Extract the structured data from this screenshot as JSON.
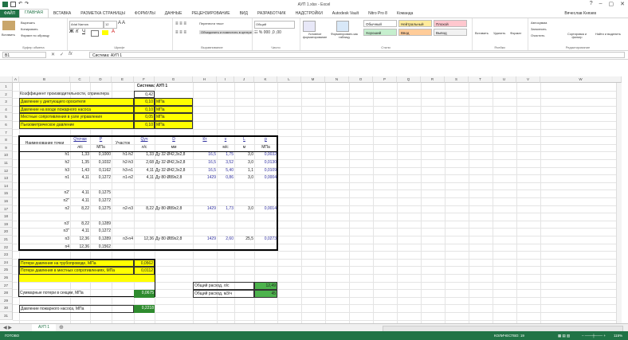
{
  "app": {
    "title": "АУП 1.xlsx - Excel",
    "user": "Вячеслав Князев"
  },
  "tabs": [
    "ФАЙЛ",
    "ГЛАВНАЯ",
    "ВСТАВКА",
    "РАЗМЕТКА СТРАНИЦЫ",
    "ФОРМУЛЫ",
    "ДАННЫЕ",
    "РЕЦЕНЗИРОВАНИЕ",
    "ВИД",
    "РАЗРАБОТЧИК",
    "НАДСТРОЙКИ",
    "Autodesk Vault",
    "Nitro Pro 8",
    "Команда"
  ],
  "ribbon": {
    "paste": "Вставить",
    "cut": "Вырезать",
    "copy": "Копировать",
    "format_painter": "Формат по образцу",
    "clipboard": "Буфер обмена",
    "font_name": "Arial Narrow",
    "font_size": "12",
    "font": "Шрифт",
    "wrap": "Перенести текст",
    "merge": "Объединить и поместить в центре",
    "alignment": "Выравнивание",
    "number_format": "Общий",
    "number": "Число",
    "conditional": "Условное форматирование",
    "format_table": "Форматировать как таблицу",
    "styles_label": "Стили",
    "style_normal": "Обычный",
    "style_neutral": "Нейтральный",
    "style_bad": "Плохой",
    "style_good": "Хороший",
    "style_input": "Ввод",
    "style_calc": "Вывод",
    "insert": "Вставить",
    "delete": "Удалить",
    "format": "Формат",
    "cells": "Ячейки",
    "autosum": "Автосумма",
    "fill": "Заполнить",
    "clear": "Очистить",
    "sort": "Сортировка и фильтр",
    "find": "Найти и выделить",
    "editing": "Редактирование"
  },
  "formula_bar": {
    "name_box": "B1",
    "formula": "Система: АУП 1"
  },
  "columns": [
    "A",
    "B",
    "C",
    "D",
    "E",
    "F",
    "G",
    "H",
    "I",
    "J",
    "K",
    "L",
    "M",
    "N",
    "O",
    "P",
    "Q",
    "R",
    "S",
    "T",
    "U",
    "V",
    "W"
  ],
  "rows": [
    "1",
    "2",
    "3",
    "4",
    "5",
    "6",
    "7",
    "8",
    "9",
    "10",
    "11",
    "12",
    "13",
    "14",
    "15",
    "16",
    "17",
    "18",
    "19",
    "20",
    "21",
    "22",
    "23",
    "24",
    "25",
    "26",
    "27",
    "28",
    "29",
    "30",
    "31"
  ],
  "cells": {
    "title": "Система: АУП 1",
    "r2_label": "Коэффициент производительности, спринклера",
    "r2_val": "0,42",
    "r3_label": "Давление у диктующего оросителя",
    "r3_val": "0,10",
    "r3_unit": "МПа",
    "r4_label": "Давление на входе пожарного насоса",
    "r4_val": "0,10",
    "r4_unit": "МПа",
    "r5_label": "Местные сопротивления в узле управления",
    "r5_val": "0,05",
    "r5_unit": "МПа",
    "r6_label": "Пьезометрическое давление",
    "r6_val": "0,10",
    "r6_unit": "МПа",
    "h_name": "Наименование точки",
    "h_q": "Qточки",
    "h_q_u": "л/с",
    "h_p": "P",
    "h_p_u": "МПа",
    "h_sec": "Участок",
    "h_qu": "Qуч",
    "h_qu_u": "л/с",
    "h_d": "D",
    "h_d_u": "мм",
    "h_kt": "Кт",
    "h_v": "v",
    "h_v_u": "м/с",
    "h_l": "L",
    "h_l_u": "м",
    "h_pp": "p",
    "h_pp_u": "МПа",
    "rows": [
      {
        "b": "h1",
        "c": "1,33",
        "d": "0,1000",
        "e": "h1-h2",
        "f": "1,33",
        "g": "Ду 32 Ø42,3х2,8",
        "h": "16,5",
        "i": "1,75",
        "j": "3,0",
        "k": "0,0032"
      },
      {
        "b": "h2",
        "c": "1,35",
        "d": "0,1032",
        "e": "h2-h3",
        "f": "2,68",
        "g": "Ду 32 Ø42,3х2,8",
        "h": "16,5",
        "i": "3,52",
        "j": "3,0",
        "k": "0,0130"
      },
      {
        "b": "h3",
        "c": "1,43",
        "d": "0,1162",
        "e": "h3-n1",
        "f": "4,11",
        "g": "Ду 32 Ø42,3х2,8",
        "h": "16,5",
        "i": "5,40",
        "j": "1,1",
        "k": "0,0109"
      },
      {
        "b": "n1",
        "c": "4,11",
        "d": "0,1272",
        "e": "n1-n2",
        "f": "4,11",
        "g": "Ду 80 Ø89х2,8",
        "h": "1429",
        "i": "0,86",
        "j": "3,0",
        "k": "0,0004"
      }
    ],
    "n2a": {
      "b": "n2'",
      "c": "4,11",
      "d": "0,1275"
    },
    "n2b": {
      "b": "n2''",
      "c": "4,11",
      "d": "0,1272"
    },
    "n2": {
      "b": "n2",
      "c": "8,22",
      "d": "0,1275",
      "e": "n2-n3",
      "f": "8,22",
      "g": "Ду 80 Ø89х2,8",
      "h": "1429",
      "i": "1,73",
      "j": "3,0",
      "k": "0,0014"
    },
    "n3a": {
      "b": "n3'",
      "c": "8,22",
      "d": "0,1289"
    },
    "n3b": {
      "b": "n3''",
      "c": "4,11",
      "d": "0,1272"
    },
    "n3": {
      "b": "n3",
      "c": "12,36",
      "d": "0,1289",
      "e": "n3-n4",
      "f": "12,36",
      "g": "Ду 80 Ø89х2,8",
      "h": "1429",
      "i": "2,60",
      "j": "25,5",
      "k": "0,0273"
    },
    "n4": {
      "b": "n4",
      "c": "12,36",
      "d": "0,1562"
    },
    "r24_label": "Потери давления на трубопроводе, МПа",
    "r24_val": "0,0562",
    "r25_label": "Потери давления в местных сопротивлениях, МПа",
    "r25_val": "0,0112",
    "r28_label": "Суммарные потери в секции, МПа",
    "r28_val": "0,0675",
    "r30_label": "Давление пожарного насоса, МПа",
    "r30_val": "0,2218",
    "r27_label": "Общий расход, л/с",
    "r27_val": "12,49",
    "r28b_label": "Общий расход, м3/ч",
    "r28b_val": "45"
  },
  "sheet_tab": "АУП 1",
  "status": {
    "ready": "ГОТОВО",
    "count": "КОЛИЧЕСТВО: 19",
    "zoom": "115%"
  }
}
